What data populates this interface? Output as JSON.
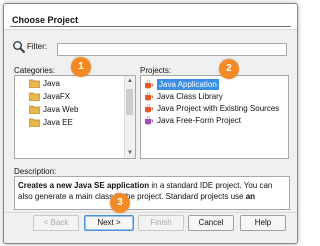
{
  "dialog": {
    "title": "Choose Project",
    "filter_label": "Filter:",
    "filter_value": ""
  },
  "categories": {
    "label": "Categories:",
    "items": [
      {
        "label": "Java"
      },
      {
        "label": "JavaFX"
      },
      {
        "label": "Java Web"
      },
      {
        "label": "Java EE"
      }
    ]
  },
  "projects": {
    "label": "Projects:",
    "selected": "Java Application",
    "items": [
      {
        "label": "Java Application"
      },
      {
        "label": "Java Class Library"
      },
      {
        "label": "Java Project with Existing Sources"
      },
      {
        "label": "Java Free-Form Project"
      }
    ]
  },
  "description": {
    "label": "Description:",
    "bold_lead": "Creates a new Java SE application",
    "text_1": " in a standard IDE project. You can also generate a main class in the project. Standard projects use ",
    "bold_tail": "an"
  },
  "buttons": {
    "back": "< Back",
    "next": "Next >",
    "finish": "Finish",
    "cancel": "Cancel",
    "help": "Help"
  },
  "badges": [
    "1",
    "2",
    "3"
  ],
  "colors": {
    "badge": "#f28b26",
    "selection": "#3a8ee6"
  },
  "icons": {
    "filter": "magnifier-icon",
    "category": "folder-icon",
    "project": "coffee-cup-icon",
    "freeform": "coffee-cup-purple-icon"
  }
}
